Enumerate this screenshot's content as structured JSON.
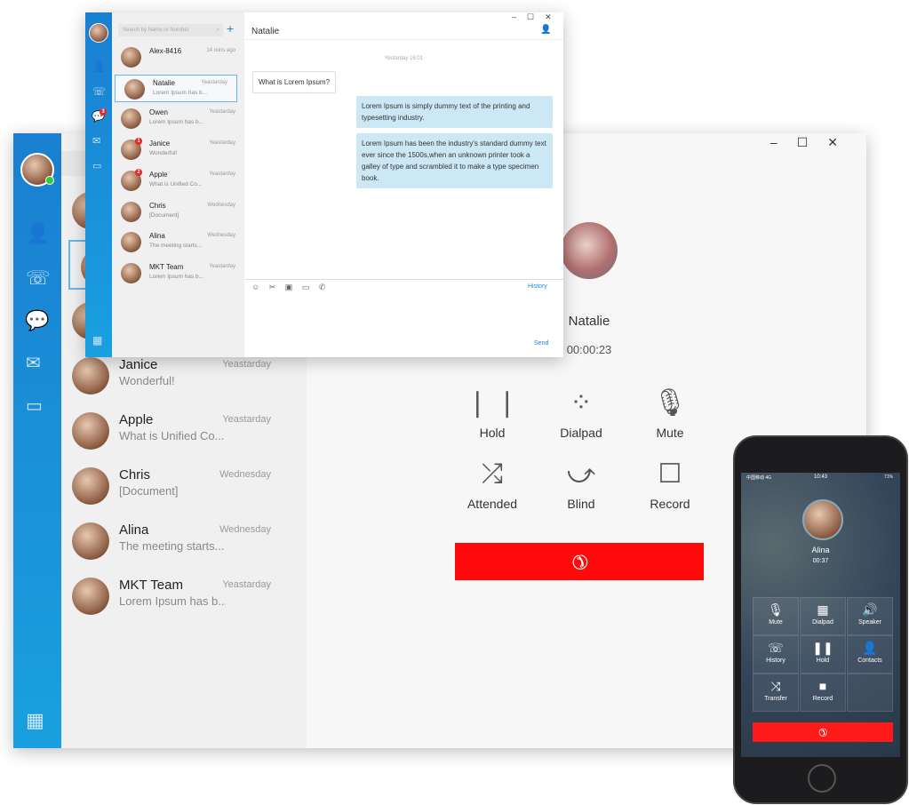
{
  "desktop": {
    "search_placeholder": "Search by Name or Number",
    "contacts": [
      {
        "name": "Alex-8416",
        "preview": "",
        "time": "14 mins ago"
      },
      {
        "name": "Natalie",
        "preview": "Lorem Ipsum has b...",
        "time": "Yeastarday",
        "selected": true
      },
      {
        "name": "Owen",
        "preview": "Lorem Ipsum has b...",
        "time": "Yeastarday"
      },
      {
        "name": "Janice",
        "preview": "Wonderful!",
        "time": "Yeastarday",
        "badge": "1"
      },
      {
        "name": "Apple",
        "preview": "What is Unified Co...",
        "time": "Yeastarday",
        "badge": "2"
      },
      {
        "name": "Chris",
        "preview": "[Document]",
        "time": "Wednesday"
      },
      {
        "name": "Alina",
        "preview": "The meeting starts...",
        "time": "Wednesday"
      },
      {
        "name": "MKT Team",
        "preview": "Lorem Ipsum has b...",
        "time": "Yeastarday"
      }
    ],
    "call": {
      "name": "Natalie",
      "timer": "00:00:23",
      "controls": [
        {
          "label": "Hold",
          "icon": "pause-icon"
        },
        {
          "label": "Dialpad",
          "icon": "dialpad-icon"
        },
        {
          "label": "Mute",
          "icon": "microphone-icon"
        },
        {
          "label": "Attended",
          "icon": "attended-transfer-icon"
        },
        {
          "label": "Blind",
          "icon": "blind-transfer-icon"
        },
        {
          "label": "Record",
          "icon": "record-icon"
        }
      ],
      "end_color": "#ff0a0a"
    },
    "sidebar_icons": [
      "contacts-icon",
      "call-history-icon",
      "chat-icon",
      "voicemail-icon",
      "fax-icon",
      "apps-icon"
    ],
    "chat_badge": "3"
  },
  "chat": {
    "title": "Natalie",
    "date": "Yestarday 16:01",
    "messages": [
      {
        "dir": "in",
        "text": "What is Lorem Ipsum?"
      },
      {
        "dir": "out",
        "text": "Lorem Ipsum is simply dummy text of the printing and typesetting industry."
      },
      {
        "dir": "out",
        "text": "Lorem Ipsum has been the industry's standard dummy text ever since the 1500s,when an unknown printer took a galley of type and scrambled it to make a type specimen book."
      }
    ],
    "history": "History",
    "send": "Send",
    "toolbar_icons": [
      "emoji-icon",
      "scissors-icon",
      "image-icon",
      "folder-icon",
      "phone-icon"
    ]
  },
  "phone": {
    "carrier": "中国移动 4G",
    "clock": "10:43",
    "battery": "71%",
    "caller": "Alina",
    "timer": "00:37",
    "buttons": [
      {
        "label": "Mute",
        "glyph": "🎙"
      },
      {
        "label": "Dialpad",
        "glyph": "▦"
      },
      {
        "label": "Speaker",
        "glyph": "🔊"
      },
      {
        "label": "History",
        "glyph": "☏"
      },
      {
        "label": "Hold",
        "glyph": "❚❚"
      },
      {
        "label": "Contacts",
        "glyph": "👤"
      },
      {
        "label": "Transfer",
        "glyph": "⤨"
      },
      {
        "label": "Record",
        "glyph": "■"
      }
    ]
  },
  "colors": {
    "brand": "#1a8ad8",
    "end_call": "#ff0a0a"
  }
}
